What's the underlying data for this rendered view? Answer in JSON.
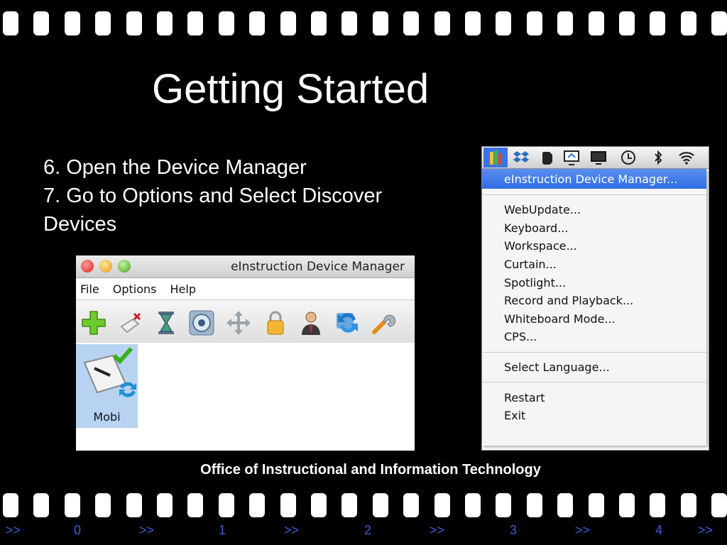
{
  "slide": {
    "title": "Getting Started",
    "steps": [
      "6. Open the Device Manager",
      "7. Go to Options and Select Discover",
      "Devices"
    ],
    "footer": "Office of Instructional and Information Technology"
  },
  "device_manager_window": {
    "title": "eInstruction Device Manager",
    "menus": [
      "File",
      "Options",
      "Help"
    ],
    "toolbar_icons": [
      "add-icon",
      "disconnect-pen-icon",
      "hourglass-icon",
      "speaker-icon",
      "move-arrows-icon",
      "lock-icon",
      "user-icon",
      "refresh-icon",
      "wrench-icon"
    ],
    "device": {
      "label": "Mobi",
      "icon": "mobi-tablet-icon"
    }
  },
  "menu_bar_dropdown": {
    "menubar_icons": [
      "einstruction-icon",
      "dropbox-icon",
      "evernote-icon",
      "screen-share-icon",
      "display-icon",
      "time-machine-icon",
      "bluetooth-icon",
      "wifi-icon"
    ],
    "highlighted_item": "eInstruction Device Manager...",
    "group1": [
      "WebUpdate...",
      "Keyboard...",
      "Workspace...",
      "Curtain...",
      "Spotlight...",
      "Record and Playback...",
      "Whiteboard Mode...",
      "CPS..."
    ],
    "group2": [
      "Select Language..."
    ],
    "group3": [
      "Restart",
      "Exit"
    ]
  },
  "slide_nav": {
    "items": [
      ">>",
      "0",
      ">>",
      "1",
      ">>",
      "2",
      ">>",
      "3",
      ">>",
      "4",
      ">>"
    ]
  },
  "colors": {
    "background": "#000000",
    "menu_highlight": "#3a74e6",
    "device_selection": "#b7d3f1",
    "nav_link": "#3a5fd9"
  }
}
